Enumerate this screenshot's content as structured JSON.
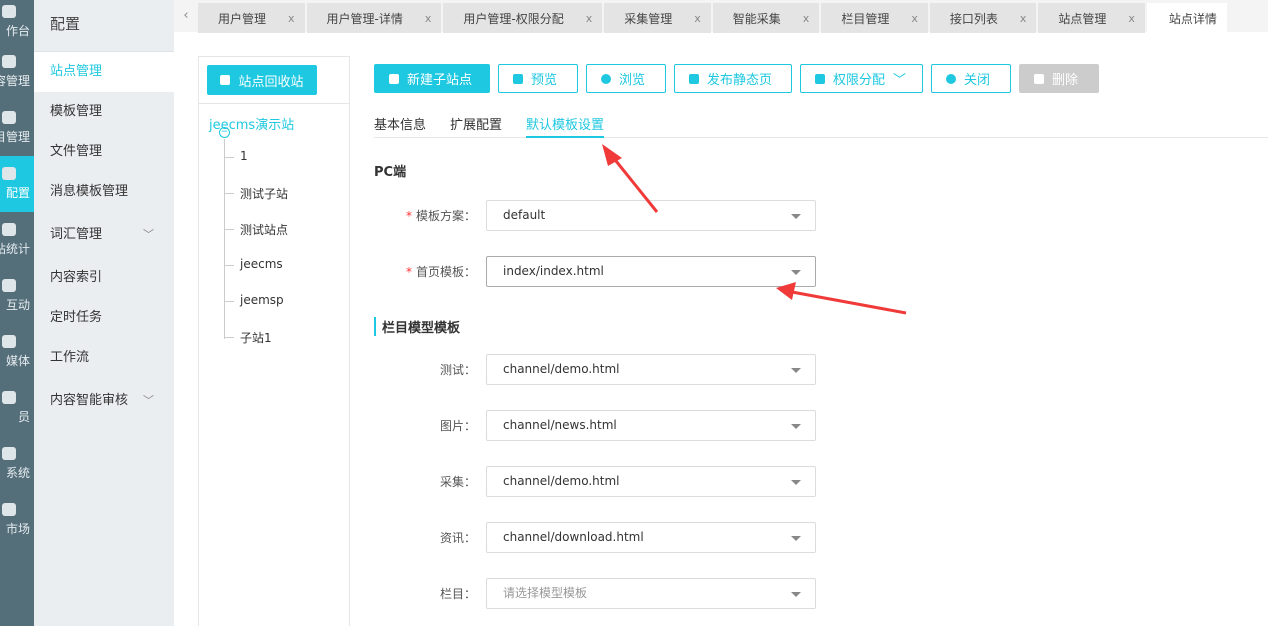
{
  "rail": [
    "作台",
    "容管理",
    "目管理",
    "配置",
    "站统计",
    "互动",
    "媒体",
    "员",
    "系统",
    "市场"
  ],
  "side": {
    "title": "配置",
    "items": [
      {
        "label": "站点管理"
      },
      {
        "label": "模板管理"
      },
      {
        "label": "文件管理"
      },
      {
        "label": "消息模板管理"
      },
      {
        "label": "词汇管理",
        "expand": true
      },
      {
        "label": "内容索引"
      },
      {
        "label": "定时任务"
      },
      {
        "label": "工作流"
      },
      {
        "label": "内容智能审核",
        "expand": true
      }
    ]
  },
  "tabs": [
    "用户管理",
    "用户管理-详情",
    "用户管理-权限分配",
    "采集管理",
    "智能采集",
    "栏目管理",
    "接口列表",
    "站点管理",
    "站点详情"
  ],
  "tab_close": "x",
  "tree": {
    "recycle": "站点回收站",
    "root": "jeecms演示站",
    "children": [
      "1",
      "测试子站",
      "测试站点",
      "jeecms",
      "jeemsp",
      "子站1"
    ]
  },
  "toolbar": {
    "new": "新建子站点",
    "preview": "预览",
    "browse": "浏览",
    "publish": "发布静态页",
    "perm": "权限分配",
    "close": "关闭",
    "delete": "删除"
  },
  "subtabs": [
    "基本信息",
    "扩展配置",
    "默认模板设置"
  ],
  "pc": {
    "title": "PC端",
    "scheme_label": "模板方案：",
    "scheme": "default",
    "home_label": "首页模板：",
    "home": "index/index.html"
  },
  "channel": {
    "title": "栏目模型模板",
    "rows": [
      {
        "label": "测试：",
        "value": "channel/demo.html"
      },
      {
        "label": "图片：",
        "value": "channel/news.html"
      },
      {
        "label": "采集：",
        "value": "channel/demo.html"
      },
      {
        "label": "资讯：",
        "value": "channel/download.html"
      },
      {
        "label": "栏目：",
        "placeholder": "请选择模型模板"
      }
    ]
  },
  "colors": {
    "accent": "#1ec8e0",
    "rail": "#546e7a",
    "arrow": "#f03a3a"
  }
}
